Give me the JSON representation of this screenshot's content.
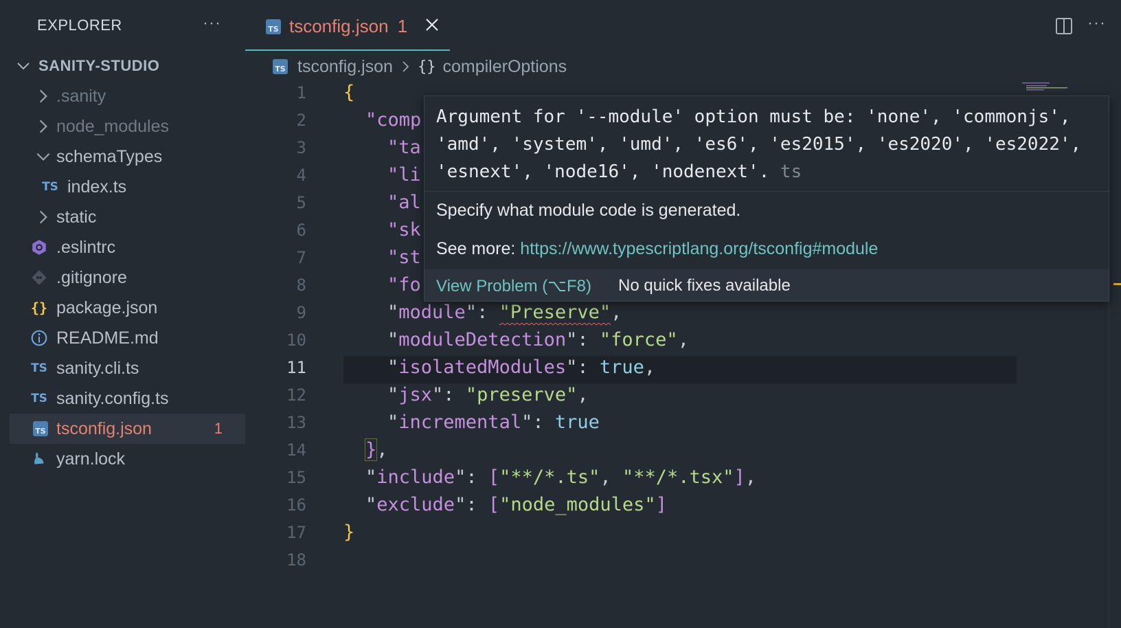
{
  "sidebar": {
    "header": "EXPLORER",
    "more": "···",
    "project": "SANITY-STUDIO",
    "items": [
      {
        "label": ".sanity",
        "icon": "chevron-right-icon",
        "dim": true
      },
      {
        "label": "node_modules",
        "icon": "chevron-right-icon",
        "dim": true
      },
      {
        "label": "schemaTypes",
        "icon": "chevron-down-icon"
      },
      {
        "label": "index.ts",
        "icon": "ts-icon",
        "icon_text": "TS"
      },
      {
        "label": "static",
        "icon": "chevron-right-icon"
      },
      {
        "label": ".eslintrc",
        "icon": "eslint-icon"
      },
      {
        "label": ".gitignore",
        "icon": "git-icon"
      },
      {
        "label": "package.json",
        "icon": "json-braces-icon",
        "icon_text": "{}"
      },
      {
        "label": "README.md",
        "icon": "info-icon"
      },
      {
        "label": "sanity.cli.ts",
        "icon": "ts-icon",
        "icon_text": "TS"
      },
      {
        "label": "sanity.config.ts",
        "icon": "ts-icon",
        "icon_text": "TS"
      },
      {
        "label": "tsconfig.json",
        "icon": "tsconfig-icon",
        "icon_text": "TS",
        "selected": true,
        "problems": "1"
      },
      {
        "label": "yarn.lock",
        "icon": "yarn-icon"
      }
    ]
  },
  "tab": {
    "title": "tsconfig.json",
    "problems": "1",
    "icon_text": "TS"
  },
  "toolbar": {
    "more": "···"
  },
  "breadcrumb": {
    "file": "tsconfig.json",
    "braces": "{}",
    "symbol": "compilerOptions"
  },
  "editor": {
    "line_numbers": [
      "1",
      "2",
      "3",
      "4",
      "5",
      "6",
      "7",
      "8",
      "9",
      "10",
      "11",
      "12",
      "13",
      "14",
      "15",
      "16",
      "17",
      "18"
    ],
    "current_line": "11",
    "code": {
      "l1": "{",
      "l2_partial": "\"comp",
      "l3_partial": "\"ta",
      "l4_partial": "\"li",
      "l5_partial": "\"al",
      "l6_partial": "\"sk",
      "l7_partial": "\"st",
      "l8_partial": "\"fo",
      "l9_key": "module",
      "l9_val": "\"Preserve\"",
      "l10_key": "moduleDetection",
      "l10_val": "\"force\"",
      "l11_key": "isolatedModules",
      "l11_val": "true",
      "l12_key": "jsx",
      "l12_val": "\"preserve\"",
      "l13_key": "incremental",
      "l13_val": "true",
      "l14": "}",
      "l15_key": "include",
      "l15_v1": "\"**/*.ts\"",
      "l15_v2": "\"**/*.tsx\"",
      "l16_key": "exclude",
      "l16_v1": "\"node_modules\"",
      "l17": "}"
    }
  },
  "hover": {
    "message": "Argument for '--module' option must be: 'none', 'commonjs', 'amd', 'system', 'umd', 'es6', 'es2015', 'es2020', 'es2022', 'esnext', 'node16', 'nodenext'.",
    "source": "ts",
    "description": "Specify what module code is generated.",
    "see_more_label": "See more:",
    "link": "https://www.typescriptlang.org/tsconfig#module",
    "view_problem": "View Problem (⌥F8)",
    "no_fixes": "No quick fixes available"
  },
  "colors": {
    "background": "#252b33",
    "accent_teal": "#5fb3b3",
    "error_orange": "#e8806f",
    "key_purple": "#c68fe0",
    "string_green": "#b8d98a",
    "brace_yellow": "#f2c94c",
    "bool_blue": "#8ecfe8"
  }
}
